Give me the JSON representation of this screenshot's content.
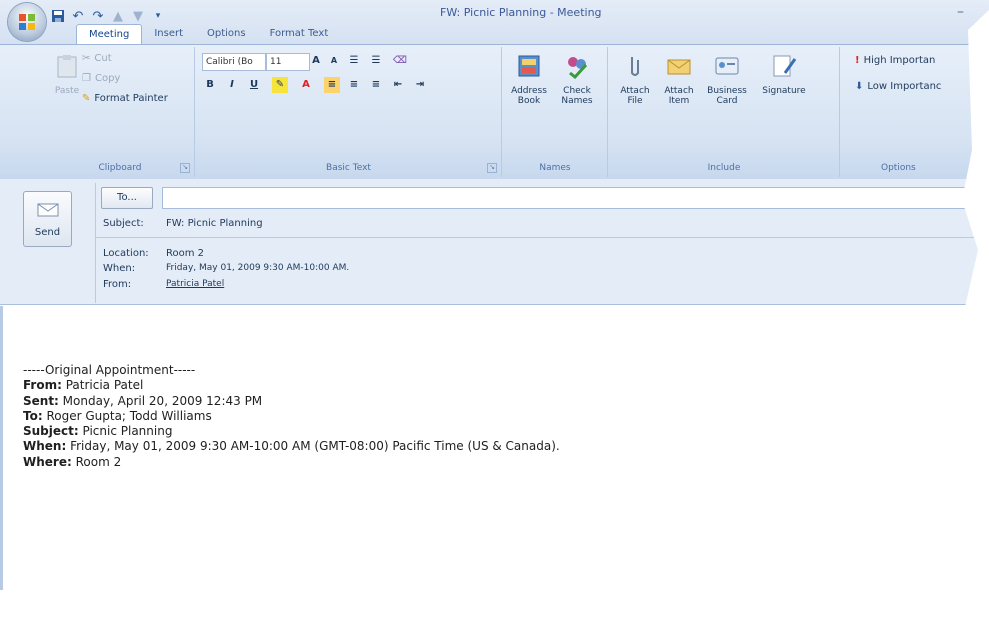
{
  "window": {
    "title": "FW: Picnic  Planning - Meeting"
  },
  "tabs": [
    "Meeting",
    "Insert",
    "Options",
    "Format Text"
  ],
  "ribbon": {
    "clipboard": {
      "paste": "Paste",
      "cut": "Cut",
      "copy": "Copy",
      "format_painter": "Format Painter",
      "caption": "Clipboard"
    },
    "basic_text": {
      "font": "Calibri (Bo",
      "size": "11",
      "caption": "Basic Text"
    },
    "names": {
      "address_book": "Address Book",
      "check_names": "Check Names",
      "caption": "Names"
    },
    "include": {
      "attach_file": "Attach File",
      "attach_item": "Attach Item",
      "business_card": "Business Card",
      "signature": "Signature",
      "caption": "Include"
    },
    "options": {
      "high_importance": "High Importan",
      "low_importance": "Low Importanc",
      "caption": "Options"
    }
  },
  "header": {
    "send": "Send",
    "to_button": "To...",
    "subject_label": "Subject:",
    "subject_value": "FW: Picnic  Planning",
    "location_label": "Location:",
    "location_value": "Room 2",
    "when_label": "When:",
    "when_value": "Friday, May 01, 2009 9:30 AM-10:00 AM.",
    "from_label": "From:",
    "from_value": "Patricia Patel"
  },
  "body": {
    "divider": "-----Original Appointment-----",
    "lines": [
      {
        "label": "From:",
        "value": " Patricia Patel"
      },
      {
        "label": "Sent:",
        "value": " Monday, April 20, 2009 12:43 PM"
      },
      {
        "label": "To:",
        "value": " Roger Gupta; Todd Williams"
      },
      {
        "label": "Subject:",
        "value": " Picnic Planning"
      },
      {
        "label": "When:",
        "value": " Friday, May 01, 2009 9:30 AM-10:00 AM (GMT-08:00) Pacific Time (US & Canada)."
      },
      {
        "label": "Where:",
        "value": " Room 2"
      }
    ]
  }
}
